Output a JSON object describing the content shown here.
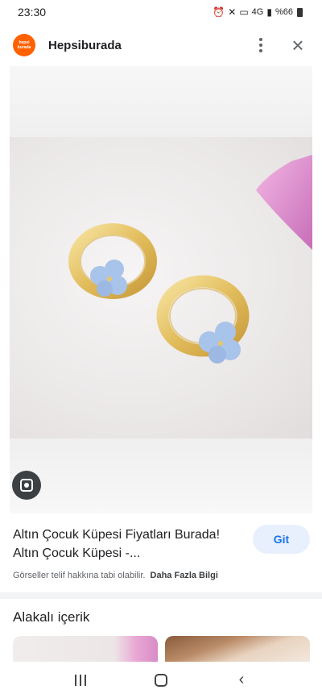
{
  "status_bar": {
    "time": "23:30",
    "network": "4G",
    "battery": "%66",
    "icons": [
      "alarm-icon",
      "mute-icon",
      "hd-icon",
      "signal-icon",
      "battery-icon"
    ]
  },
  "top_bar": {
    "logo_text": "hepsi burada",
    "site_name": "Hepsiburada",
    "icons": [
      "more-vert-icon",
      "close-icon"
    ]
  },
  "image": {
    "subject": "earrings-photo",
    "colors": {
      "gold": "#e8c66a",
      "flower": "#a9c4ea",
      "background": "#ece9e9",
      "pink_fabric": "#d884c9"
    }
  },
  "result": {
    "title": "Altın Çocuk Küpesi Fiyatları Burada! Altın Çocuk Küpesi -...",
    "visit_label": "Git",
    "copyright": "Görseller telif hakkına tabi olabilir.",
    "more_info": "Daha Fazla Bilgi"
  },
  "related": {
    "title": "Alakalı içerik"
  },
  "colors": {
    "accent": "#1a73e8",
    "accent_bg": "#e8f0fe",
    "brand": "#ff6000"
  }
}
